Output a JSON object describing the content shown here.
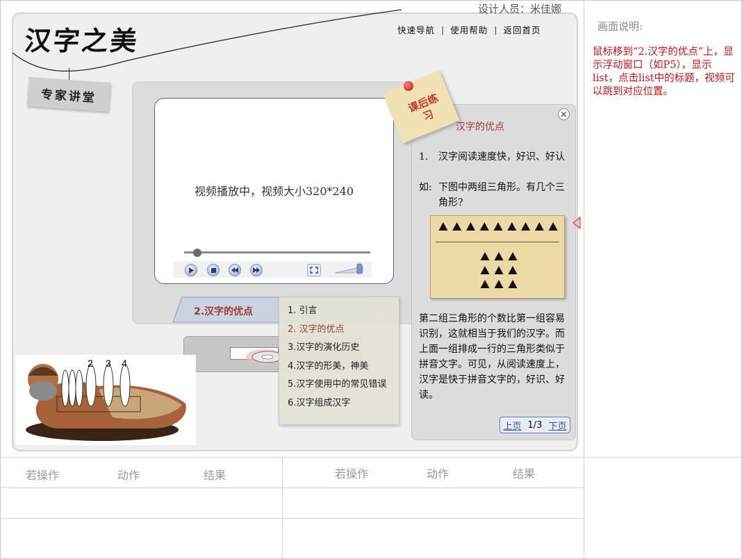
{
  "designer_line": "设计人员：米佳娜",
  "app": {
    "title": "汉字之美",
    "sign": "专家讲堂"
  },
  "top_nav": [
    "快速导航",
    "使用帮助",
    "返回首页"
  ],
  "player": {
    "status_text": "视频播放中，视频大小320*240",
    "progress": 0.07,
    "volume_level": 0.8,
    "controls": [
      "play-icon",
      "stop-icon",
      "rewind-icon",
      "fast-forward-icon",
      "fullscreen-icon",
      "volume-icon"
    ]
  },
  "chapter": {
    "current": "2.汉字的优点",
    "items": [
      "1. 引言",
      "2. 汉字的优点",
      "3.汉字的演化历史",
      "4.汉字的形美，神美",
      "5.汉字使用中的常见错误",
      "6.汉字组成汉字"
    ],
    "active_index": 1
  },
  "figurine": {
    "plates": [
      "2",
      "3",
      "4"
    ]
  },
  "sticky_note": {
    "text": "课后练习"
  },
  "info_panel": {
    "title": "汉字的优点",
    "point_num": "1.",
    "point": "汉字阅读速度快，好识、好认",
    "example_prefix": "如:",
    "example": "下图中两组三角形。有几个三角形?",
    "body": "第二组三角形的个数比第一组容易识别，这就相当于我们的汉字。而上面一组排成一行的三角形类似于拼音文字。可见，从阅读速度上，汉字是快于拼音文字的，好识、好读。",
    "row_triangles": 9,
    "grid_triangles": 9,
    "pager": {
      "prev": "上页",
      "count": "1/3",
      "next": "下页"
    }
  },
  "annotation": {
    "heading": "画面说明:",
    "body": "鼠标移到“2.汉字的优点”上，显示浮动窗口（如P5），显示list，点击list中的标题，视频可以跳到对应位置。"
  },
  "table": {
    "headers_left": [
      "若操作",
      "动作",
      "结果"
    ],
    "headers_right": [
      "若操作",
      "动作",
      "结果"
    ]
  },
  "colors": {
    "accent_red": "#a23a2e",
    "note_red": "#c0141a",
    "link_blue": "#2d56a8",
    "screen_border": "#4d6b92"
  }
}
